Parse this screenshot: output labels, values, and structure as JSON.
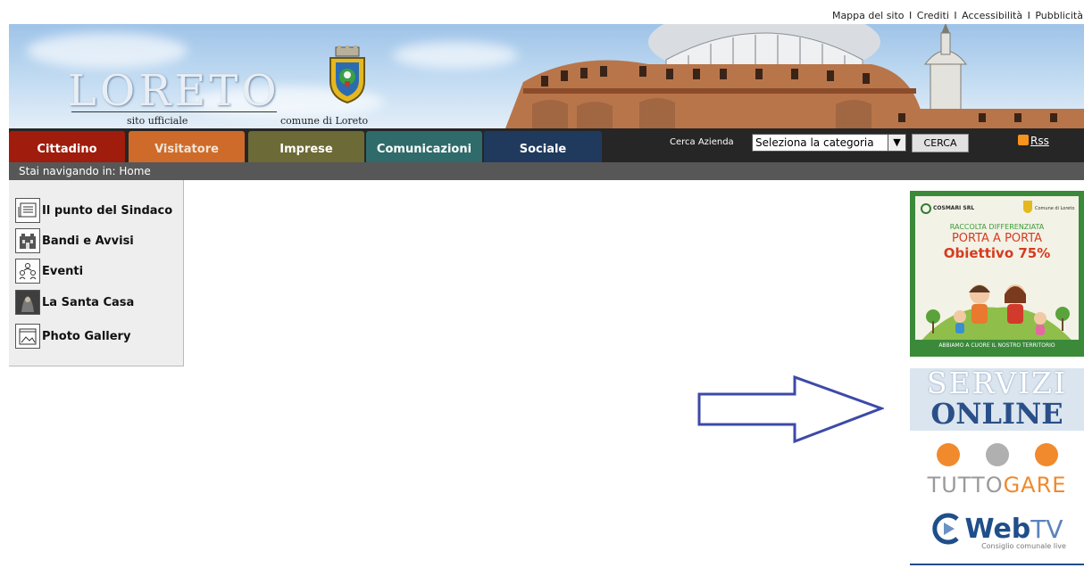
{
  "top_links": {
    "mappa": "Mappa del sito",
    "crediti": "Crediti",
    "accessibilita": "Accessibilità",
    "pubblicita": "Pubblicità",
    "separator": "I"
  },
  "header": {
    "logo_title": "LORETO",
    "logo_subtitle_left": "sito ufficiale",
    "logo_subtitle_right": "comune di Loreto"
  },
  "nav": {
    "tabs": [
      {
        "label": "Cittadino",
        "color": "#a01c0c"
      },
      {
        "label": "Visitatore",
        "color": "#cf6b2a"
      },
      {
        "label": "Imprese",
        "color": "#6c6a37"
      },
      {
        "label": "Comunicazioni",
        "color": "#2f6b6a"
      },
      {
        "label": "Sociale",
        "color": "#1f3a5d"
      }
    ],
    "search_label": "Cerca Azienda",
    "search_select_value": "Seleziona la categoria",
    "search_button": "CERCA",
    "rss_label": "Rss"
  },
  "breadcrumb": {
    "text": "Stai navigando in: Home"
  },
  "sidebar": {
    "items": [
      {
        "label": "Il punto del Sindaco",
        "icon": "newspaper-icon"
      },
      {
        "label": "Bandi e Avvisi",
        "icon": "building-icon"
      },
      {
        "label": "Eventi",
        "icon": "people-icon"
      },
      {
        "label": "La Santa Casa",
        "icon": "madonna-icon"
      },
      {
        "label": "Photo Gallery",
        "icon": "photo-icon"
      }
    ]
  },
  "banners": {
    "cosmari": {
      "company": "COSMARI SRL",
      "comune": "Comune di Loreto",
      "line1": "RACCOLTA DIFFERENZIATA",
      "line2": "PORTA A PORTA",
      "line3": "Obiettivo 75%",
      "footer": "ABBIAMO A CUORE IL NOSTRO TERRITORIO"
    },
    "servizi": {
      "line1": "SERVIZI",
      "line2": "ONLINE"
    },
    "tuttogare": {
      "part1": "TUTTO",
      "part2": "GARE"
    },
    "webtv": {
      "brand_bold": "Web",
      "brand_light": "TV",
      "tagline": "Consiglio comunale live"
    }
  },
  "colors": {
    "navbar_bg": "#262626",
    "breadcrumb_bg": "#575757",
    "cosmari_green": "#3b8a3a",
    "servizi_blue": "#2a4f88",
    "tuttogare_orange": "#f08a2c",
    "webtv_blue": "#1f4f8a",
    "arrow_blue": "#3c4aa8"
  }
}
